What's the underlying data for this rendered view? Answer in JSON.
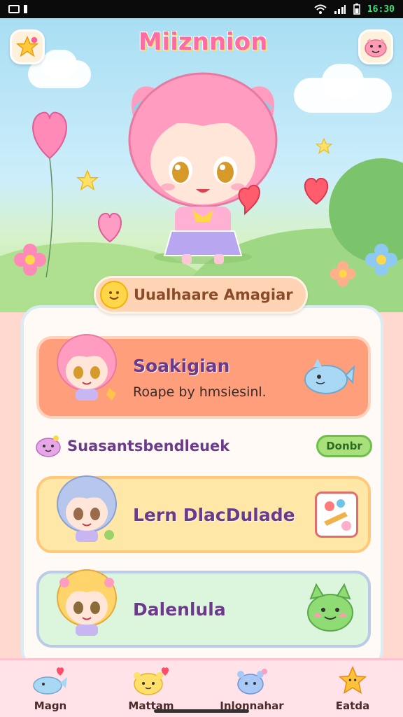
{
  "status_bar": {
    "time": "16:30",
    "icons": [
      "sim-icon",
      "bell-icon",
      "wifi-icon",
      "signal-icon",
      "battery-icon"
    ]
  },
  "header": {
    "title": "Miiznnion",
    "left_button_icon": "star-icon",
    "right_button_icon": "pig-face-icon"
  },
  "banner": {
    "label": "Uualhaare Amagiar",
    "icon": "smile-icon"
  },
  "cards": [
    {
      "name": "Soakigian",
      "subtitle": "Roape by hmsiesinl.",
      "icon": "whale-icon"
    },
    {
      "name": "Lern DlacDulade",
      "icon": "paint-card-icon"
    },
    {
      "name": "Dalenlula",
      "icon": "green-cat-icon"
    }
  ],
  "section": {
    "label": "Suasantsbendleuek",
    "button": "Donbr"
  },
  "nav": [
    {
      "label": "Magn",
      "icon": "whale-heart-icon"
    },
    {
      "label": "Mattam",
      "icon": "bear-heart-icon"
    },
    {
      "label": "Inlonnahar",
      "icon": "blue-creature-icon"
    },
    {
      "label": "Eatda",
      "icon": "star-creature-icon"
    }
  ],
  "colors": {
    "accent_pink": "#ff6ba6",
    "card_orange": "#ff9e7a",
    "card_yellow": "#ffe7a8",
    "card_green": "#dcf5dd",
    "status_time": "#39e07a"
  }
}
